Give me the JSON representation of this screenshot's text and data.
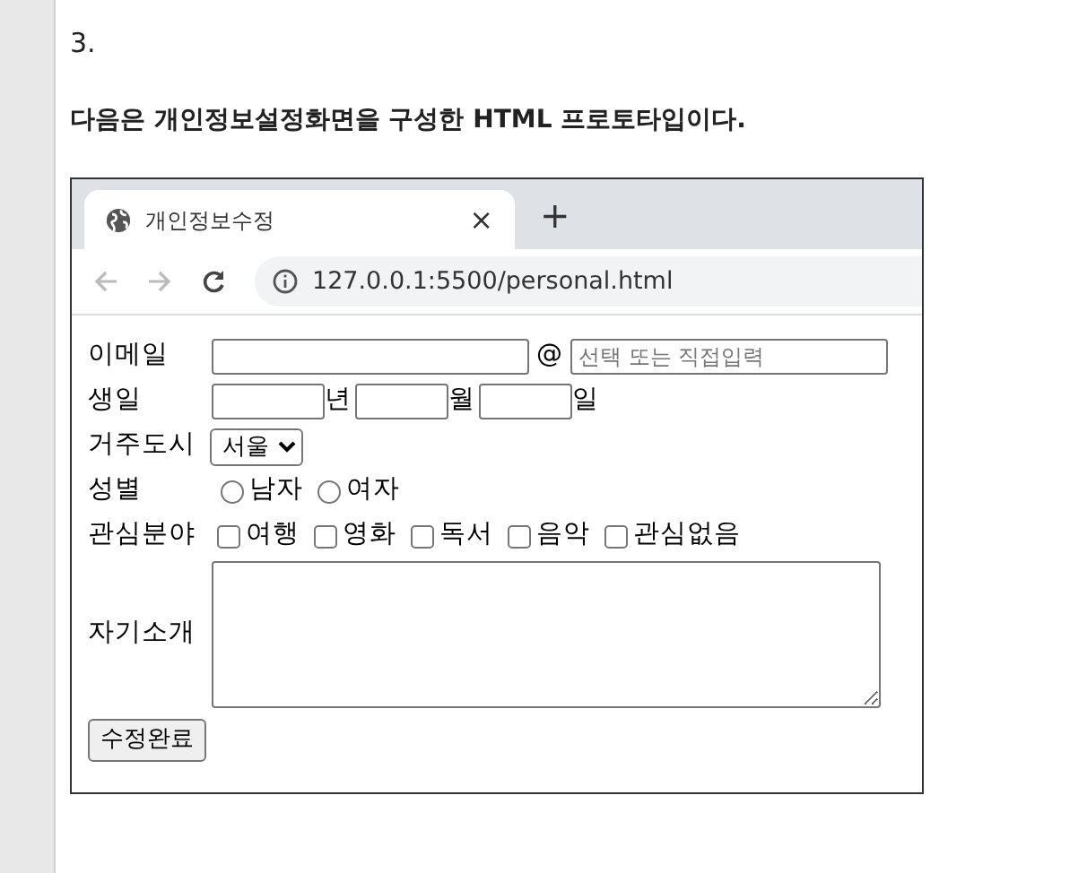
{
  "question": {
    "number": "3.",
    "text": "다음은 개인정보설정화면을 구성한 HTML 프로토타입이다."
  },
  "browser": {
    "tab_title": "개인정보수정",
    "tab_close": "×",
    "new_tab": "+",
    "url": "127.0.0.1:5500/personal.html"
  },
  "form": {
    "rows": [
      {
        "kind": "email",
        "label": "이메일",
        "at": "@",
        "placeholder": "선택 또는 직접입력"
      },
      {
        "kind": "date",
        "label": "생일",
        "suffixes": [
          "년",
          "월",
          "일"
        ]
      },
      {
        "kind": "select",
        "label": "거주도시",
        "value": "서울"
      },
      {
        "kind": "radio",
        "label": "성별",
        "options": [
          {
            "label": "남자",
            "checked": false
          },
          {
            "label": "여자",
            "checked": false
          }
        ]
      },
      {
        "kind": "checkbox",
        "label": "관심분야",
        "options": [
          {
            "label": "여행",
            "checked": false
          },
          {
            "label": "영화",
            "checked": false
          },
          {
            "label": "독서",
            "checked": false
          },
          {
            "label": "음악",
            "checked": false
          },
          {
            "label": "관심없음",
            "checked": false
          }
        ]
      },
      {
        "kind": "textarea",
        "label": "자기소개"
      }
    ],
    "submit": "수정완료"
  }
}
